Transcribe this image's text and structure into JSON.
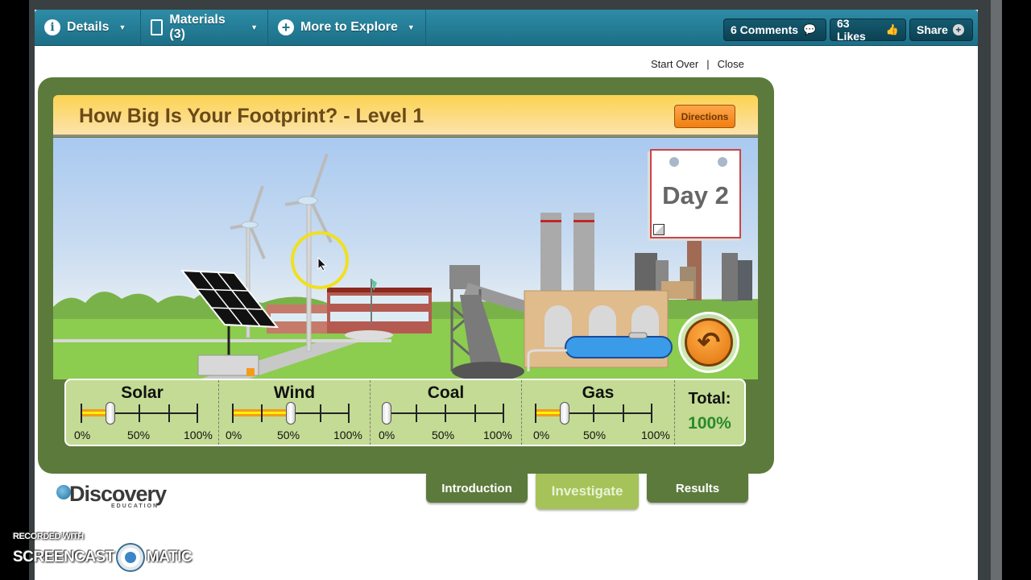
{
  "topbar": {
    "nav": [
      {
        "label": "Details",
        "icon": "info-icon"
      },
      {
        "label": "Materials (3)",
        "icon": "notebook-icon"
      },
      {
        "label": "More to Explore",
        "icon": "plus-circle-icon"
      }
    ],
    "actions": [
      {
        "label": "6 Comments",
        "icon": "speech-bubble-icon"
      },
      {
        "label": "63 Likes",
        "icon": "thumbs-up-icon"
      },
      {
        "label": "Share",
        "icon": "plus-circle-icon"
      }
    ]
  },
  "links": {
    "start_over": "Start Over",
    "separator": "|",
    "close": "Close"
  },
  "game": {
    "title": "How Big Is Your Footprint? - Level 1",
    "directions_label": "Directions",
    "day_label": "Day 2",
    "back_icon": "undo-arrow-icon",
    "sources": [
      {
        "name": "Solar",
        "value_percent": 25,
        "ticks": [
          "0%",
          "50%",
          "100%"
        ]
      },
      {
        "name": "Wind",
        "value_percent": 50,
        "ticks": [
          "0%",
          "50%",
          "100%"
        ]
      },
      {
        "name": "Coal",
        "value_percent": 0,
        "ticks": [
          "0%",
          "50%",
          "100%"
        ]
      },
      {
        "name": "Gas",
        "value_percent": 25,
        "ticks": [
          "0%",
          "50%",
          "100%"
        ]
      }
    ],
    "total_label": "Total:",
    "total_value": "100%",
    "total_color": "#2a8a2a"
  },
  "tabs": [
    {
      "label": "Introduction",
      "active": false
    },
    {
      "label": "Investigate",
      "active": true
    },
    {
      "label": "Results",
      "active": false
    }
  ],
  "logo": {
    "main": "Discovery",
    "sub": "EDUCATION"
  },
  "watermark": {
    "line1": "RECORDED WITH",
    "brand_left": "SCREENCAST",
    "brand_right": "MATIC"
  },
  "colors": {
    "topbar": "#2d8ca6",
    "game_frame": "#5c7a3c",
    "header": "#fbd351",
    "directions": "#f07f10",
    "active_tab": "#a5c359"
  }
}
